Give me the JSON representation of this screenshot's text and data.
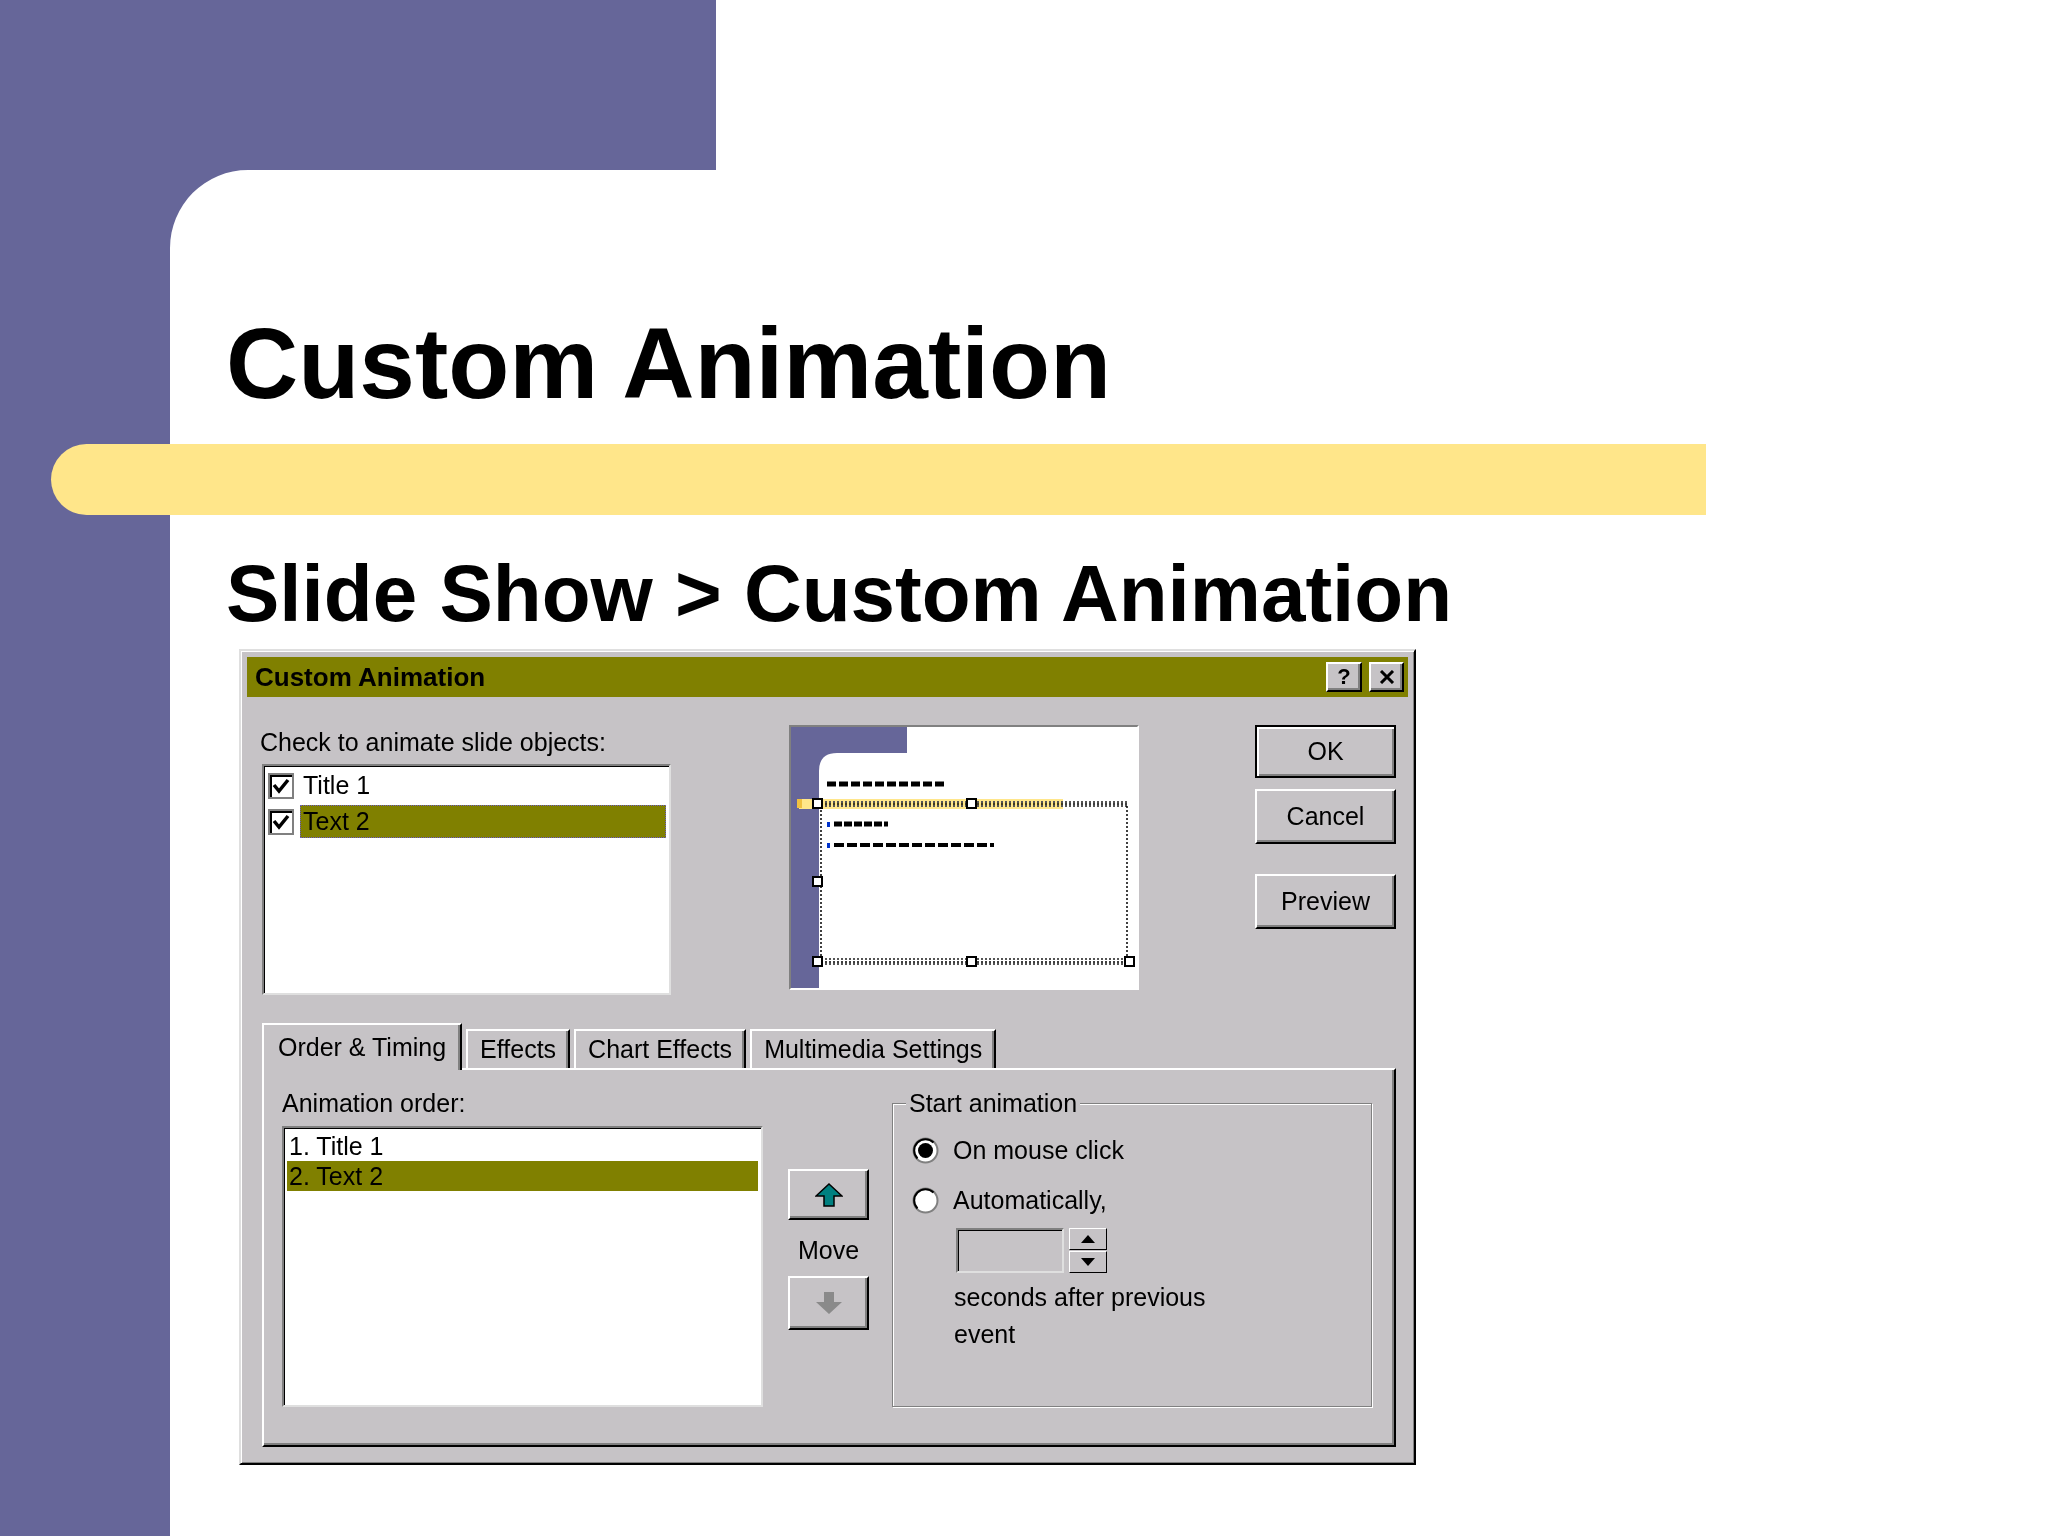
{
  "slide": {
    "title": "Custom Animation",
    "subtitle": "Slide Show > Custom Animation"
  },
  "dialog": {
    "title": "Custom Animation",
    "help_button": "?",
    "objects_label": "Check to animate slide objects:",
    "objects": [
      {
        "label": "Title 1",
        "checked": true,
        "selected": false
      },
      {
        "label": "Text 2",
        "checked": true,
        "selected": true
      }
    ],
    "buttons": [
      {
        "label": "OK",
        "default": true
      },
      {
        "label": "Cancel",
        "default": false
      },
      {
        "label": "Preview",
        "default": false
      }
    ],
    "tabs": [
      {
        "label": "Order & Timing",
        "selected": true
      },
      {
        "label": "Effects",
        "selected": false
      },
      {
        "label": "Chart Effects",
        "selected": false
      },
      {
        "label": "Multimedia Settings",
        "selected": false
      }
    ],
    "order_label": "Animation order:",
    "order": [
      {
        "label": "1. Title 1",
        "selected": false
      },
      {
        "label": "2. Text 2",
        "selected": true
      }
    ],
    "move_label": "Move",
    "move_buttons": [
      {
        "kind": "up",
        "disabled": false
      },
      {
        "kind": "down",
        "disabled": true
      }
    ],
    "start_group": {
      "title": "Start animation",
      "options": [
        {
          "label": "On mouse click",
          "selected": true
        },
        {
          "label": "Automatically,",
          "selected": false
        }
      ],
      "delay_field": {
        "disabled": true
      },
      "delay_caption": "seconds after previous event"
    }
  }
}
